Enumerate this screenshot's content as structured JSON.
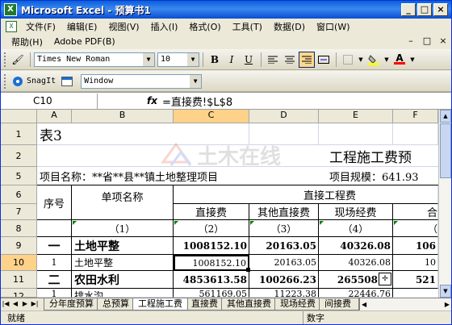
{
  "window": {
    "title": "Microsoft Excel - 预算书1",
    "app_icon": "excel-icon",
    "minimize": "_",
    "maximize": "□",
    "close": "×"
  },
  "menu": {
    "row1": [
      "文件(F)",
      "编辑(E)",
      "视图(V)",
      "插入(I)",
      "格式(O)",
      "工具(T)",
      "数据(D)",
      "窗口(W)"
    ],
    "row2": [
      "帮助(H)",
      "Adobe PDF(B)"
    ],
    "mdi_controls": [
      "–",
      "□",
      "×"
    ]
  },
  "toolbar1": {
    "font": "Times New Roman",
    "size": "10",
    "bold": "B",
    "italic": "I",
    "underline": "U",
    "font_color_letter": "A"
  },
  "toolbar2": {
    "snagit": "SnagIt",
    "window_combo": "Window"
  },
  "formula_bar": {
    "name_box": "C10",
    "fx": "fx",
    "formula": "=直接费!$L$8"
  },
  "columns": [
    "A",
    "B",
    "C",
    "D",
    "E",
    "F"
  ],
  "rows": [
    "1",
    "2",
    "5",
    "6",
    "7",
    "8",
    "9",
    "10",
    "11",
    "12"
  ],
  "cells": {
    "r1": "表3",
    "r2": "工程施工费预",
    "r5_left": "项目名称：**省**县**镇土地整理项目",
    "r5_right": "项目规模：641.93",
    "hdr_seq": "序号",
    "hdr_name": "单项名称",
    "hdr_direct_group": "直接工程费",
    "hdr_direct": "直接费",
    "hdr_other_direct": "其他直接费",
    "hdr_site": "现场经费",
    "hdr_f": "合",
    "idx_b": "（1）",
    "idx_c": "（2）",
    "idx_d": "（3）",
    "idx_e": "（4）",
    "idx_f": "（",
    "r9": [
      "一",
      "土地平整",
      "1008152.10",
      "20163.05",
      "40326.08",
      "106"
    ],
    "r10": [
      "1",
      "土地平整",
      "1008152.10",
      "20163.05",
      "40326.08",
      "10"
    ],
    "r11": [
      "二",
      "农田水利",
      "4853613.58",
      "100266.23",
      "265508",
      "521"
    ],
    "r12": [
      "1",
      "排水沟",
      "561169.05",
      "11223.38",
      "22446.76",
      ""
    ]
  },
  "watermark": "土木在线",
  "sheet_tabs": [
    "分年度预算",
    "总预算",
    "工程施工费",
    "直接费",
    "其他直接费",
    "现场经费",
    "间接费"
  ],
  "active_tab": "工程施工费",
  "status": {
    "text": "就绪",
    "mode": "数字"
  }
}
